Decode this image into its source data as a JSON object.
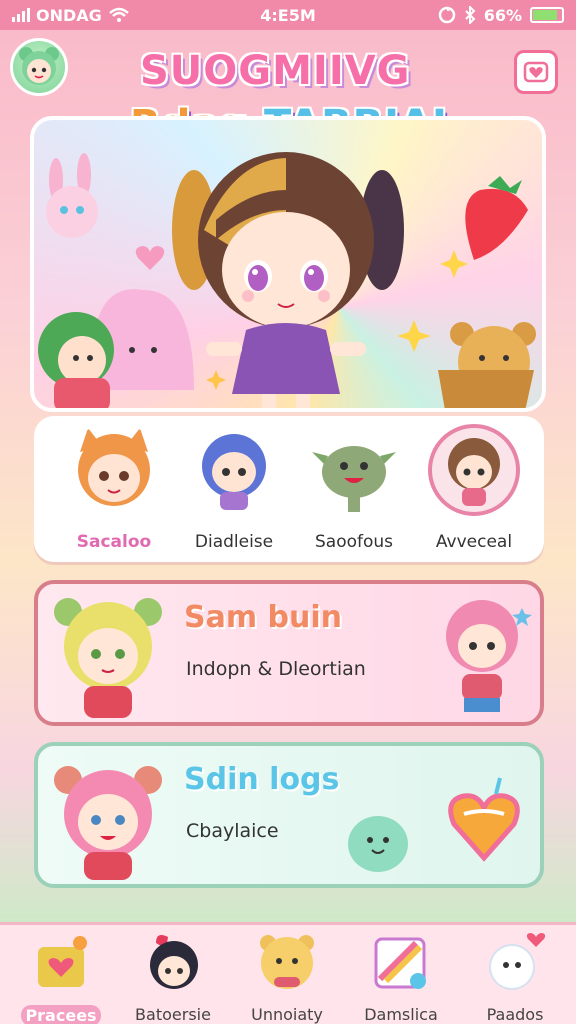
{
  "status_bar": {
    "carrier": "ONDAG",
    "time": "4:E5M",
    "battery": "66%",
    "battery_level": 0.8
  },
  "header": {
    "title_line1": "SUOGMIIVG",
    "title_line2a": "Rdag",
    "title_line2b": "TABBIAI"
  },
  "characters": {
    "items": [
      {
        "label": "Sacaloo",
        "active": true
      },
      {
        "label": "Diadleise",
        "active": false
      },
      {
        "label": "Saoofous",
        "active": false
      },
      {
        "label": "Avveceal",
        "active": false
      }
    ]
  },
  "cards": [
    {
      "title": "Sam buin",
      "subtitle": "Indopn & Dleortian"
    },
    {
      "title": "Sdin logs",
      "subtitle": "Cbaylaice"
    }
  ],
  "tabs": [
    {
      "label": "Pracees",
      "active": true
    },
    {
      "label": "Batoersie",
      "active": false
    },
    {
      "label": "Unnoiaty",
      "active": false
    },
    {
      "label": "Damslica",
      "active": false
    },
    {
      "label": "Paados",
      "active": false
    }
  ],
  "colors": {
    "accent": "#f08aa8",
    "card1_border": "#d77e8a",
    "card2_border": "#9bd0b9"
  }
}
